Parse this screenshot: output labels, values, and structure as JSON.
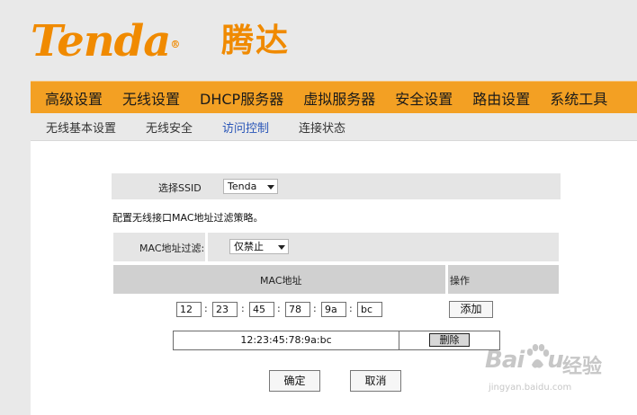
{
  "brand": {
    "name": "Tenda",
    "reg": "®",
    "name_cn": "腾达",
    "color": "#f08a00"
  },
  "nav": {
    "items": [
      "高级设置",
      "无线设置",
      "DHCP服务器",
      "虚拟服务器",
      "安全设置",
      "路由设置",
      "系统工具"
    ],
    "active_index": 1,
    "bar_color": "#f3a023"
  },
  "subnav": {
    "items": [
      "无线基本设置",
      "无线安全",
      "访问控制",
      "连接状态"
    ],
    "active_index": 2,
    "active_color": "#2a56b8"
  },
  "form": {
    "ssid_label": "选择SSID",
    "ssid_value": "Tenda",
    "description": "配置无线接口MAC地址过滤策略。",
    "filter_label": "MAC地址过滤:",
    "filter_value": "仅禁止",
    "table": {
      "col_mac": "MAC地址",
      "col_action": "操作"
    },
    "mac_octets": [
      "12",
      "23",
      "45",
      "78",
      "9a",
      "bc"
    ],
    "add_label": "添加",
    "entries": [
      {
        "mac": "12:23:45:78:9a:bc",
        "delete_label": "删除"
      }
    ],
    "ok_label": "确定",
    "cancel_label": "取消"
  },
  "watermark": {
    "brand": "Bai",
    "brand_tail": "u",
    "text_cn": "经验",
    "url": "jingyan.baidu.com",
    "paw_icon": "baidu-paw-icon"
  }
}
